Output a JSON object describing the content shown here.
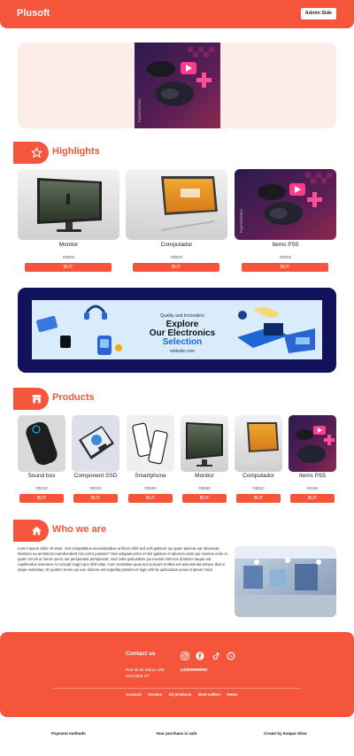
{
  "header": {
    "logo": "Plusoft",
    "admin_button": "Admin Side"
  },
  "highlights": {
    "title": "Highlights",
    "items": [
      {
        "name": "Monitor",
        "price": "R$990",
        "buy": "BUY"
      },
      {
        "name": "Computador",
        "price": "R$920",
        "buy": "BUY"
      },
      {
        "name": "Items PS5",
        "price": "R$350",
        "buy": "BUY"
      }
    ]
  },
  "banner": {
    "small": "Quality and Innovation",
    "line1": "Explore",
    "line2": "Our Electronics",
    "line3": "Selection",
    "site": "website.com"
  },
  "products": {
    "title": "Products",
    "items": [
      {
        "name": "Sound box",
        "price": "R$150",
        "buy": "BUY"
      },
      {
        "name": "Component SSD",
        "price": "R$320",
        "buy": "BUY"
      },
      {
        "name": "Smartphone",
        "price": "R$850",
        "buy": "BUY"
      },
      {
        "name": "Monitor",
        "price": "R$990",
        "buy": "BUY"
      },
      {
        "name": "Computador",
        "price": "R$920",
        "buy": "BUY"
      },
      {
        "name": "Items PS5",
        "price": "R$350",
        "buy": "BUY"
      }
    ]
  },
  "about": {
    "title": "Who we are",
    "text": "Lorem ipsum dolor sit amet. Sed voluptatibus necessitatibus ut libero nihil sed velit galisum qui quam placeat aut obcaecati. Nostrum ea architecto reprehenderit non porro possimi? Sed voluptas porro et sint galisum et laborum dolor qui maxime enim et quam omnis ut harum porro aut perspiciatis perspiciatis. Sed nulla quibusdam qui eveniet internos id labore itaque aut repellendus inventore At corrupti magni quo nihil vitae. Cum molestiae quas aut nesciunt mollitia est assumenda tempor illus in atque molestiae. Et quidem nemo qui iure doloren est expedita possimt et fugit velit sit quibusdam iuniut et ipsum modi."
  },
  "footer": {
    "contact": "Contact us",
    "address_line1": "Rua 26 de Março 180,",
    "address_line2": "Sorocaba-SP",
    "phone": "(15)999999992",
    "links": [
      "Account",
      "Service",
      "All products",
      "Best sellers",
      "News"
    ],
    "social_icons": [
      "instagram-icon",
      "facebook-icon",
      "tiktok-icon",
      "whatsapp-icon"
    ]
  },
  "bottom": {
    "payment": "Payment methods",
    "safe": "Your purchase is safe",
    "credit": "Create by Kaique Silva"
  },
  "colors": {
    "accent": "#f4553b",
    "hero_bg": "#fdede9",
    "banner_bg": "#12125a"
  }
}
